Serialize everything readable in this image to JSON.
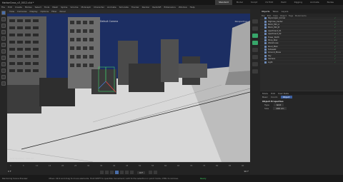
{
  "window": {
    "title": "HarborCross_v3_0012.c4d *"
  },
  "title_tabs": [
    "Standard",
    "Model",
    "Sculpt",
    "UV Edit",
    "Paint",
    "Rigging",
    "Animate",
    "Nodes"
  ],
  "menubar": [
    "File",
    "Edit",
    "Create",
    "Modes",
    "Select",
    "Tools",
    "Mesh",
    "Spline",
    "Volume",
    "MoGraph",
    "Character",
    "Animate",
    "Simulate",
    "Tracker",
    "Render",
    "Redshift",
    "Extensions",
    "Window",
    "Help"
  ],
  "viewport": {
    "menu": [
      "View",
      "Cameras",
      "Display",
      "Options",
      "Filter",
      "Panel"
    ],
    "camera_label": "Default Camera",
    "top_right": "Perspective",
    "grid_label": "Grid Spacing : 100 cm"
  },
  "right_tabs": [
    "Objects",
    "Takes",
    "Layers"
  ],
  "objects_menu": [
    "File",
    "Edit",
    "View",
    "Object",
    "Tags",
    "Bookmarks"
  ],
  "objects": [
    {
      "name": "Skyscraper_Corner"
    },
    {
      "name": "Highrise_Center"
    },
    {
      "name": "Block_Mid_A"
    },
    {
      "name": "Block_Mid_B"
    },
    {
      "name": "Apartment_01"
    },
    {
      "name": "Apartment_02"
    },
    {
      "name": "Tower_North"
    },
    {
      "name": "Shop_Row"
    },
    {
      "name": "Warehouse"
    },
    {
      "name": "Road_Main"
    },
    {
      "name": "Sidewalk"
    },
    {
      "name": "Ground_Plane"
    },
    {
      "name": "Sky"
    },
    {
      "name": "Camera"
    },
    {
      "name": "Light"
    }
  ],
  "attributes": {
    "tabs": [
      "Mode",
      "Edit",
      "User Data"
    ],
    "sub": [
      "Basic",
      "Coord.",
      "Object"
    ],
    "section": "Object Properties",
    "props": [
      {
        "label": "Type",
        "value": "Grid"
      },
      {
        "label": "Size",
        "value": "100 cm"
      }
    ]
  },
  "timeline": {
    "ticks": [
      "0",
      "5",
      "10",
      "15",
      "20",
      "25",
      "30",
      "35",
      "40",
      "45",
      "50",
      "55",
      "60",
      "65",
      "70",
      "75",
      "80",
      "85",
      "90"
    ],
    "current_frame": "0 F",
    "start": "0 F",
    "end": "90 F"
  },
  "status": {
    "left": "Rendering Scene Preview",
    "message": "Move: Click and drag to move elements. Hold SHIFT to quantize movement / add to the selection in point mode, CTRL to remove.",
    "state": "Ready"
  },
  "colors": {
    "accent": "#4a6ea9",
    "sky": "#1c2e63",
    "ground": "#d8d8d8",
    "check": "#37c85a"
  }
}
